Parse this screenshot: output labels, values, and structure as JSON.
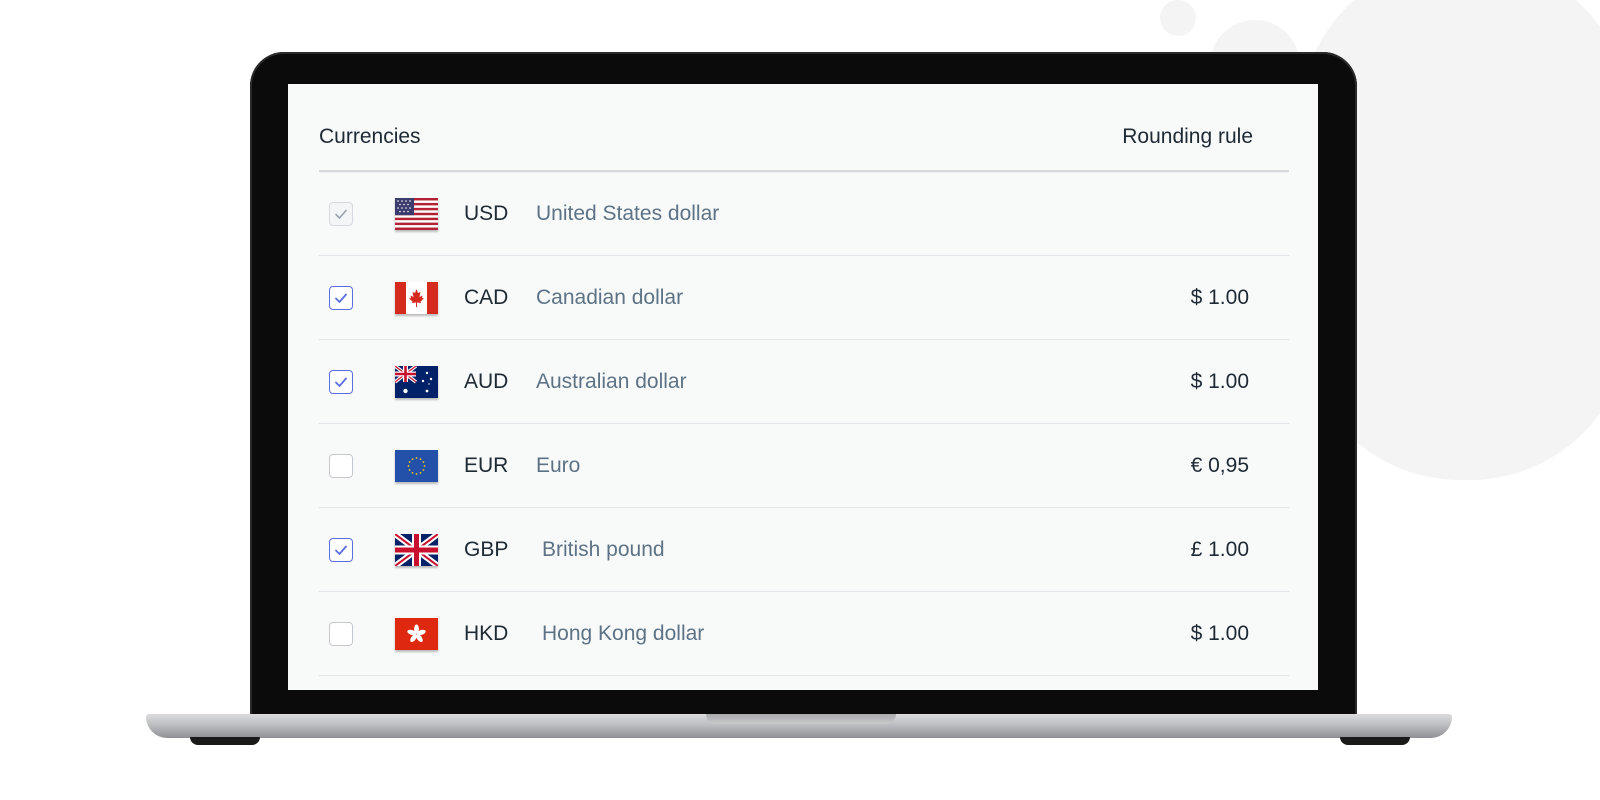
{
  "header": {
    "currencies_label": "Currencies",
    "rounding_label": "Rounding rule"
  },
  "rows": [
    {
      "code": "USD",
      "name": "United States dollar",
      "rounding": "",
      "checked": true,
      "disabled": true,
      "flag": "us-flag-icon"
    },
    {
      "code": "CAD",
      "name": "Canadian dollar",
      "rounding": "$ 1.00",
      "checked": true,
      "disabled": false,
      "flag": "canada-flag-icon"
    },
    {
      "code": "AUD",
      "name": "Australian dollar",
      "rounding": "$ 1.00",
      "checked": true,
      "disabled": false,
      "flag": "australia-flag-icon"
    },
    {
      "code": "EUR",
      "name": "Euro",
      "rounding": "€ 0,95",
      "checked": false,
      "disabled": false,
      "flag": "eu-flag-icon"
    },
    {
      "code": "GBP",
      "name": "British pound",
      "rounding": "£ 1.00",
      "checked": true,
      "disabled": false,
      "flag": "uk-flag-icon"
    },
    {
      "code": "HKD",
      "name": "Hong Kong dollar",
      "rounding": "$ 1.00",
      "checked": false,
      "disabled": false,
      "flag": "hong-kong-flag-icon"
    }
  ],
  "colors": {
    "accent": "#5b6ee1",
    "name_text": "#5d7385",
    "screen_bg": "#f8fafa"
  }
}
